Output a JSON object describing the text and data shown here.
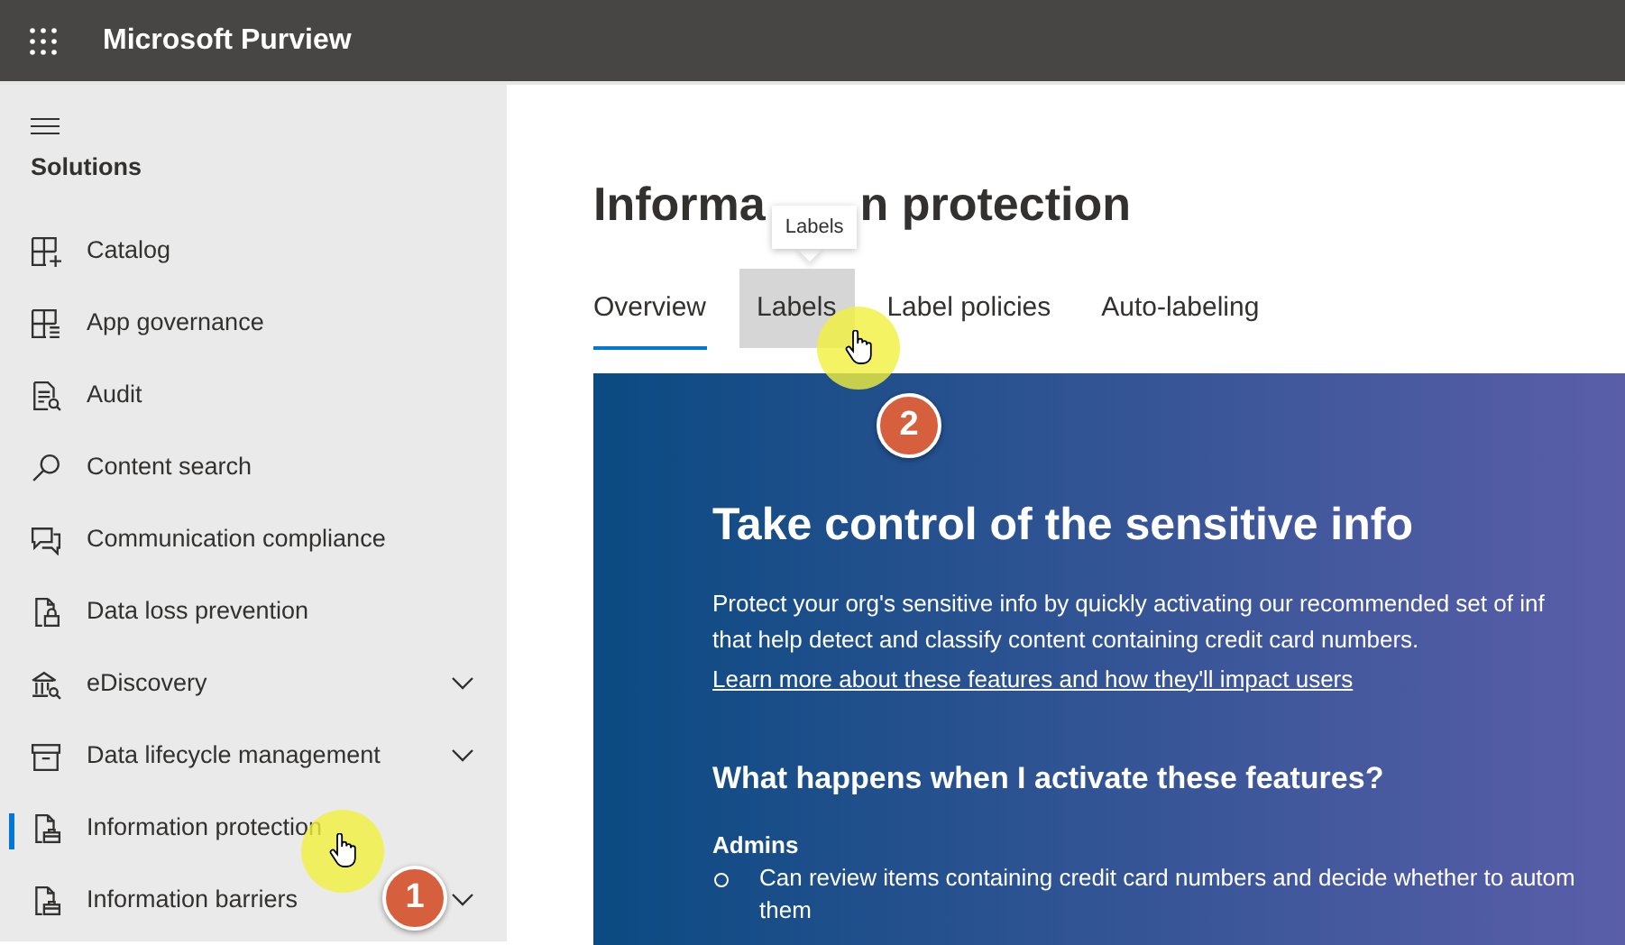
{
  "app_bar": {
    "title": "Microsoft Purview"
  },
  "sidebar": {
    "heading": "Solutions",
    "items": [
      {
        "label": "Catalog",
        "selected": false,
        "expandable": false
      },
      {
        "label": "App governance",
        "selected": false,
        "expandable": false
      },
      {
        "label": "Audit",
        "selected": false,
        "expandable": false
      },
      {
        "label": "Content search",
        "selected": false,
        "expandable": false
      },
      {
        "label": "Communication compliance",
        "selected": false,
        "expandable": false
      },
      {
        "label": "Data loss prevention",
        "selected": false,
        "expandable": false
      },
      {
        "label": "eDiscovery",
        "selected": false,
        "expandable": true
      },
      {
        "label": "Data lifecycle management",
        "selected": false,
        "expandable": true
      },
      {
        "label": "Information protection",
        "selected": true,
        "expandable": false
      },
      {
        "label": "Information barriers",
        "selected": false,
        "expandable": true
      }
    ]
  },
  "page": {
    "title_parts": [
      "Informa",
      "n protection"
    ],
    "tabs": [
      {
        "label": "Overview",
        "selected": true,
        "hovered": false
      },
      {
        "label": "Labels",
        "selected": false,
        "hovered": true
      },
      {
        "label": "Label policies",
        "selected": false,
        "hovered": false
      },
      {
        "label": "Auto-labeling",
        "selected": false,
        "hovered": false
      }
    ],
    "tooltip": "Labels"
  },
  "banner": {
    "title": "Take control of the sensitive info",
    "description_lines": [
      "Protect your org's sensitive info by quickly activating our recommended set of inf",
      "that help detect and classify content containing credit card numbers."
    ],
    "link": "Learn more about these features and how they'll impact users",
    "subheading": "What happens when I activate these features?",
    "group_label": "Admins",
    "bullet_lines": [
      "Can review items containing credit card numbers and decide whether to autom",
      "them"
    ]
  },
  "callouts": [
    {
      "number": "1"
    },
    {
      "number": "2"
    }
  ]
}
